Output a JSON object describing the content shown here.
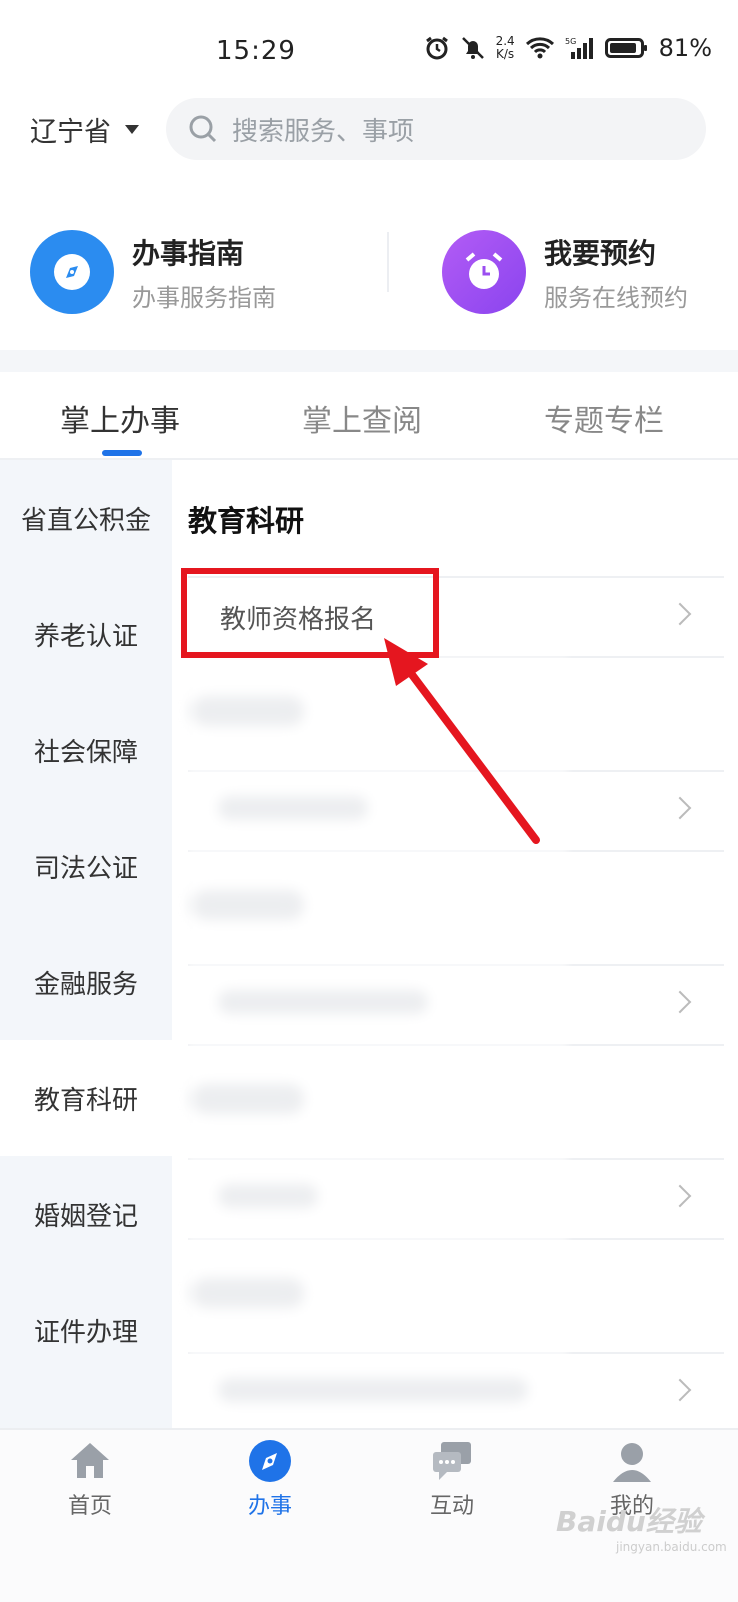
{
  "status": {
    "time": "15:29",
    "net_speed_value": "2.4",
    "net_speed_unit": "K/s",
    "signal": "5G",
    "battery": "81%"
  },
  "header": {
    "region": "辽宁省",
    "search_placeholder": "搜索服务、事项"
  },
  "quick": [
    {
      "title": "办事指南",
      "subtitle": "办事服务指南",
      "color": "#2b8cf0",
      "icon": "compass-icon"
    },
    {
      "title": "我要预约",
      "subtitle": "服务在线预约",
      "color": "#9b4ef0",
      "icon": "alarm-clock-icon"
    }
  ],
  "tabs": [
    "掌上办事",
    "掌上查阅",
    "专题专栏"
  ],
  "active_tab": "掌上办事",
  "sidebar": [
    "省直公积金",
    "养老认证",
    "社会保障",
    "司法公证",
    "金融服务",
    "教育科研",
    "婚姻登记",
    "证件办理"
  ],
  "active_sidebar": "教育科研",
  "content": {
    "section_title": "教育科研",
    "first_item": "教师资格报名"
  },
  "bottom_nav": [
    {
      "label": "首页",
      "icon": "home-icon"
    },
    {
      "label": "办事",
      "icon": "compass-icon"
    },
    {
      "label": "互动",
      "icon": "chat-icon"
    },
    {
      "label": "我的",
      "icon": "user-icon"
    }
  ],
  "active_nav": "办事",
  "accent_color": "#1f73e8",
  "annotation_color": "#e5161f",
  "watermark": "Baidu经验",
  "watermark_sub": "jingyan.baidu.com"
}
